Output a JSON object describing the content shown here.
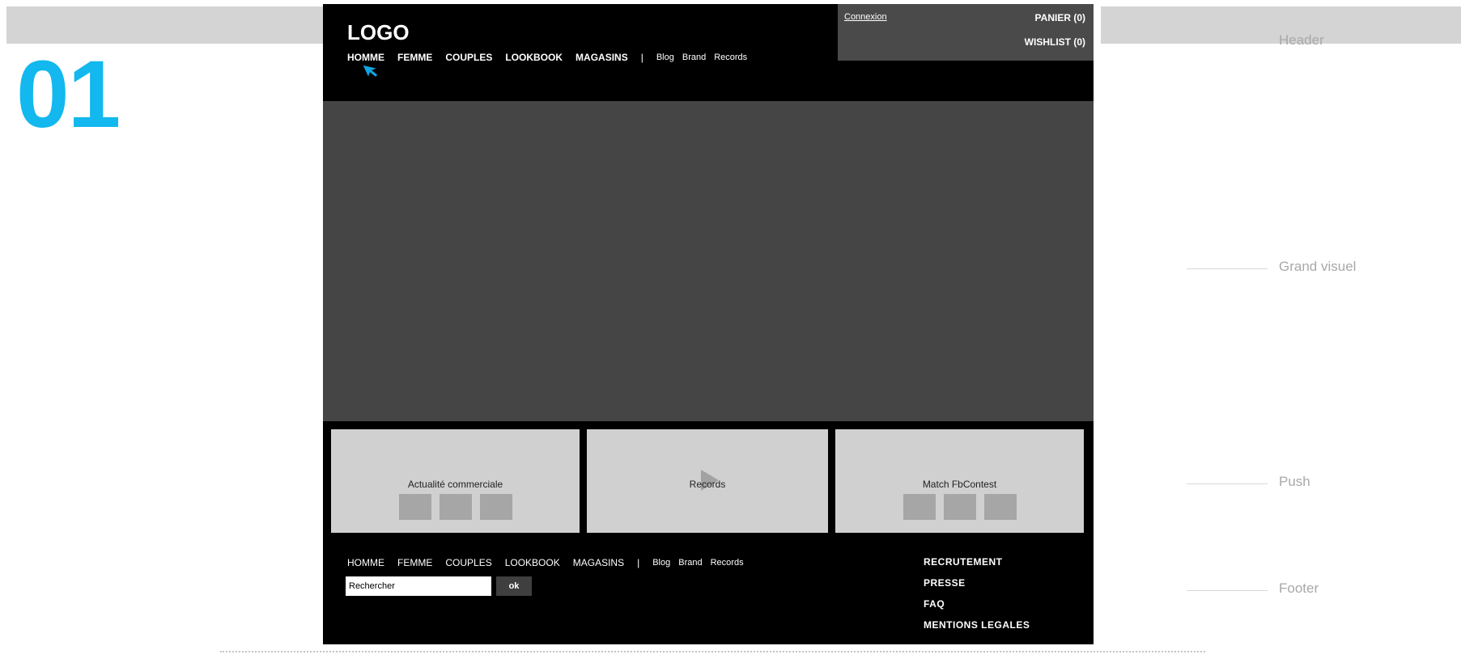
{
  "step": {
    "number": "01"
  },
  "annotations": {
    "header": "Header",
    "hero": "Grand visuel",
    "push": "Push",
    "footer": "Footer"
  },
  "header": {
    "logo": "LOGO",
    "nav": {
      "primary": [
        "HOMME",
        "FEMME",
        "COUPLES",
        "LOOKBOOK",
        "MAGASINS"
      ],
      "separator": "|",
      "secondary": [
        "Blog",
        "Brand",
        "Records"
      ]
    },
    "account": {
      "login_link": "Connexion",
      "cart": "PANIER (0)",
      "wishlist": "WISHLIST (0)"
    }
  },
  "pushes": [
    {
      "label": "Actualité commerciale",
      "thumbs": 3
    },
    {
      "label": "Records",
      "thumbs": 0
    },
    {
      "label": "Match FbContest",
      "thumbs": 3
    }
  ],
  "footer": {
    "nav": {
      "primary": [
        "HOMME",
        "FEMME",
        "COUPLES",
        "LOOKBOOK",
        "MAGASINS"
      ],
      "separator": "|",
      "secondary": [
        "Blog",
        "Brand",
        "Records"
      ]
    },
    "search": {
      "value": "Rechercher",
      "button": "ok"
    },
    "links": [
      "RECRUTEMENT",
      "PRESSE",
      "FAQ",
      "MENTIONS LEGALES"
    ]
  },
  "colors": {
    "accent": "#12b8ee",
    "frame": "#000000",
    "hero": "#454545",
    "push": "#d0d0d0",
    "account_box": "#4a4a4a"
  },
  "icons": {
    "cursor": "pointer-cursor-icon",
    "play": "play-icon"
  }
}
